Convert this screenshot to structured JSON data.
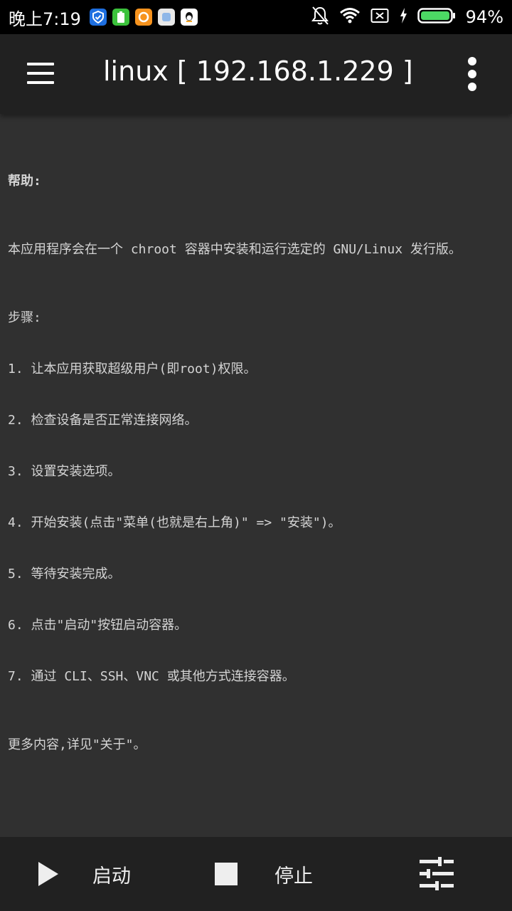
{
  "status_bar": {
    "time": "晚上7:19",
    "battery_percent": "94%",
    "apps": [
      "shield-icon",
      "battery-app-icon",
      "uc-browser-icon",
      "square-app-icon",
      "qq-icon"
    ]
  },
  "app_bar": {
    "title": "linux  [ 192.168.1.229 ]"
  },
  "help": {
    "heading": "帮助:",
    "intro": "本应用程序会在一个 chroot 容器中安装和运行选定的 GNU/Linux 发行版。",
    "steps_heading": "步骤:",
    "steps": [
      "1. 让本应用获取超级用户(即root)权限。",
      "2. 检查设备是否正常连接网络。",
      "3. 设置安装选项。",
      "4. 开始安装(点击\"菜单(也就是右上角)\" => \"安装\")。",
      "5. 等待安装完成。",
      "6. 点击\"启动\"按钮启动容器。",
      "7. 通过 CLI、SSH、VNC 或其他方式连接容器。"
    ],
    "more": "更多内容,详见\"关于\"。"
  },
  "bottom_bar": {
    "start_label": "启动",
    "stop_label": "停止"
  },
  "colors": {
    "background": "#303030",
    "app_bar": "#212121",
    "battery_green": "#4cd964"
  }
}
